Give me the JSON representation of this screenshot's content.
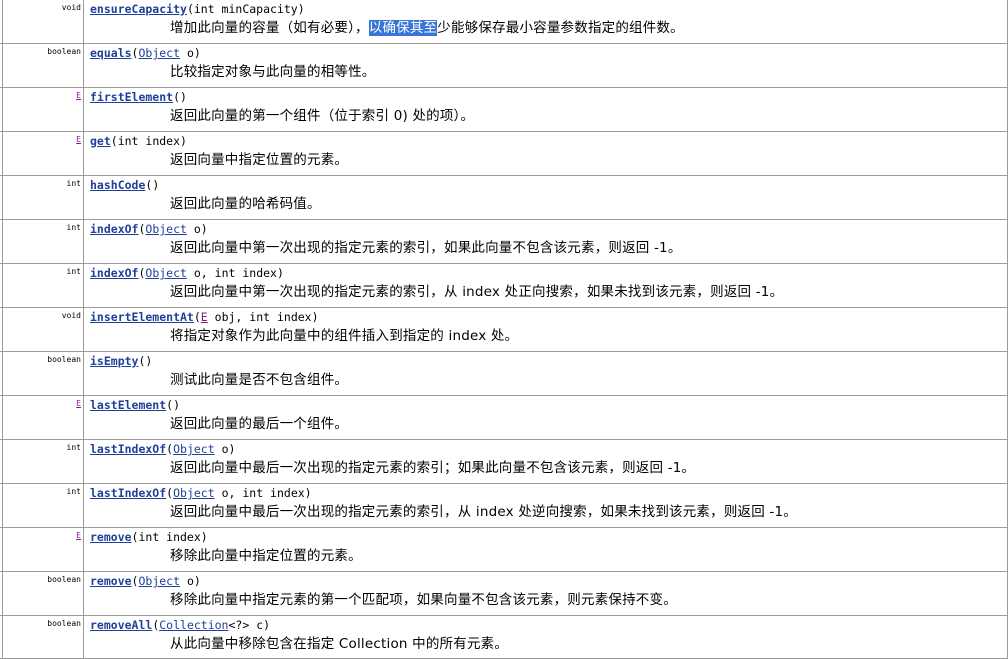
{
  "methods": [
    {
      "return_type": "void",
      "name": "ensureCapacity",
      "params_before": "(int minCapacity)",
      "link_text": "",
      "params_after": "",
      "description_before": "增加此向量的容量（如有必要），",
      "description_selected": "以确保其至",
      "description_after": "少能够保存最小容量参数指定的组件数。"
    },
    {
      "return_type": "boolean",
      "name": "equals",
      "params_before": "(",
      "link_text": "Object",
      "params_after": " o)",
      "description": "比较指定对象与此向量的相等性。"
    },
    {
      "return_type": "E",
      "name": "firstElement",
      "params_before": "()",
      "link_text": "",
      "params_after": "",
      "description": "返回此向量的第一个组件（位于索引 0) 处的项）。"
    },
    {
      "return_type": "E",
      "name": "get",
      "params_before": "(int index)",
      "link_text": "",
      "params_after": "",
      "description": "返回向量中指定位置的元素。"
    },
    {
      "return_type": "int",
      "name": "hashCode",
      "params_before": "()",
      "link_text": "",
      "params_after": "",
      "description": "返回此向量的哈希码值。"
    },
    {
      "return_type": "int",
      "name": "indexOf",
      "params_before": "(",
      "link_text": "Object",
      "params_after": " o)",
      "description": "返回此向量中第一次出现的指定元素的索引，如果此向量不包含该元素，则返回 -1。"
    },
    {
      "return_type": "int",
      "name": "indexOf",
      "params_before": "(",
      "link_text": "Object",
      "params_after": " o, int index)",
      "description": "返回此向量中第一次出现的指定元素的索引，从 index 处正向搜索，如果未找到该元素，则返回 -1。"
    },
    {
      "return_type": "void",
      "name": "insertElementAt",
      "params_before": "(",
      "link_text": "E",
      "params_after": " obj, int index)",
      "description": "将指定对象作为此向量中的组件插入到指定的 index 处。"
    },
    {
      "return_type": "boolean",
      "name": "isEmpty",
      "params_before": "()",
      "link_text": "",
      "params_after": "",
      "description": "测试此向量是否不包含组件。"
    },
    {
      "return_type": "E",
      "name": "lastElement",
      "params_before": "()",
      "link_text": "",
      "params_after": "",
      "description": "返回此向量的最后一个组件。"
    },
    {
      "return_type": "int",
      "name": "lastIndexOf",
      "params_before": "(",
      "link_text": "Object",
      "params_after": " o)",
      "description": "返回此向量中最后一次出现的指定元素的索引；如果此向量不包含该元素，则返回 -1。"
    },
    {
      "return_type": "int",
      "name": "lastIndexOf",
      "params_before": "(",
      "link_text": "Object",
      "params_after": " o, int index)",
      "description": "返回此向量中最后一次出现的指定元素的索引，从 index 处逆向搜索，如果未找到该元素，则返回 -1。"
    },
    {
      "return_type": "E",
      "name": "remove",
      "params_before": "(int index)",
      "link_text": "",
      "params_after": "",
      "description": "移除此向量中指定位置的元素。"
    },
    {
      "return_type": "boolean",
      "name": "remove",
      "params_before": "(",
      "link_text": "Object",
      "params_after": " o)",
      "description": "移除此向量中指定元素的第一个匹配项，如果向量不包含该元素，则元素保持不变。"
    },
    {
      "return_type": "boolean",
      "name": "removeAll",
      "params_before": "(",
      "link_text": "Collection",
      "params_after": "<?> c)",
      "description": "从此向量中移除包含在指定 Collection 中的所有元素。"
    }
  ],
  "colors": {
    "method_link": "#1f3f9a",
    "generic_link": "#8b1a8b",
    "selection_bg": "#3875d7",
    "border": "#9a9a9a"
  }
}
